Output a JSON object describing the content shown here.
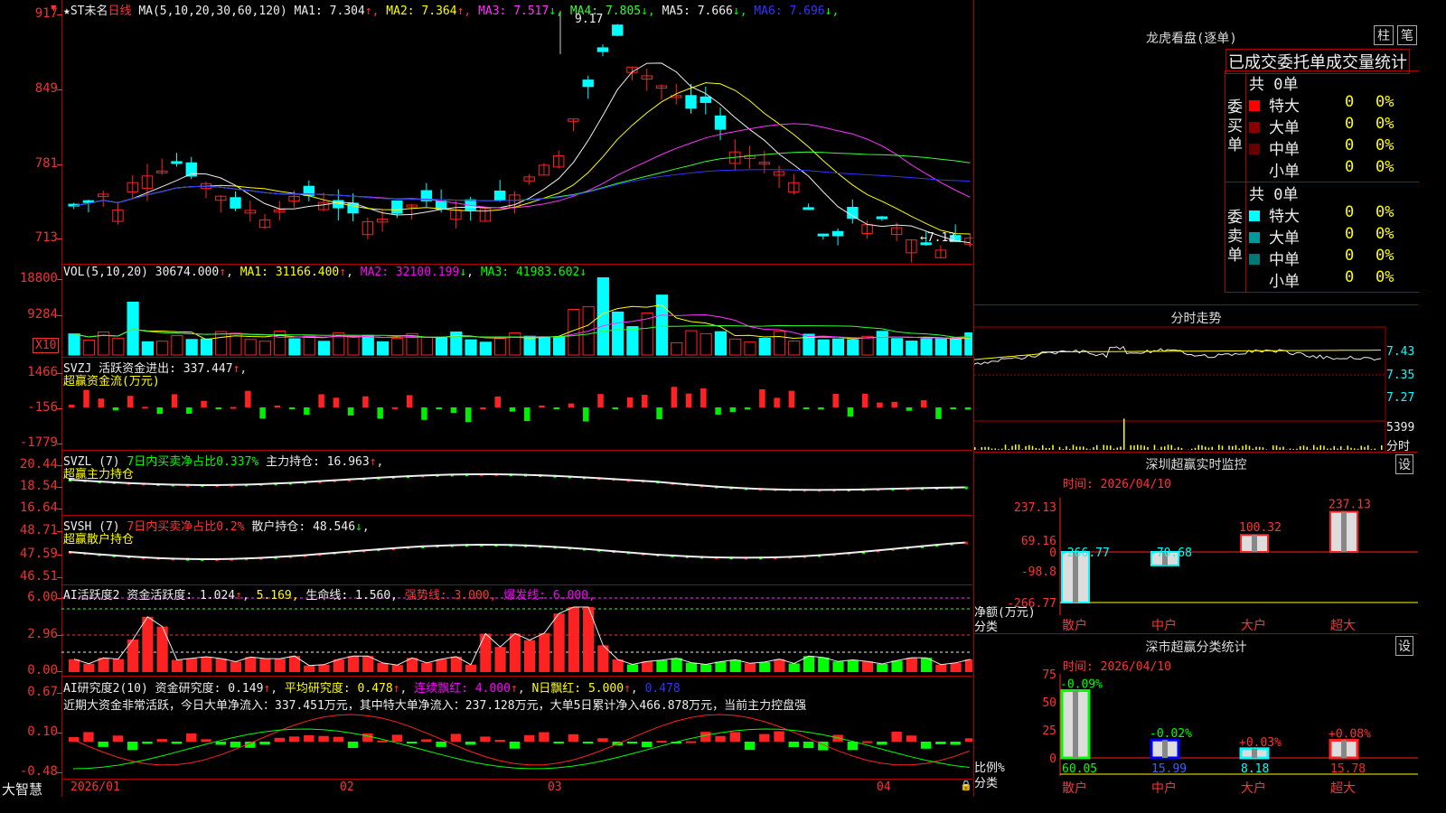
{
  "main": {
    "title_stock": "★ST未名",
    "title_period": "日线",
    "ma_label": "MA(5,10,20,30,60,120)",
    "ma": [
      {
        "label": "MA1: 7.304",
        "color": "#eeeeee",
        "arrow": "↑"
      },
      {
        "label": "MA2: 7.364",
        "color": "#ffff00",
        "arrow": "↑"
      },
      {
        "label": "MA3: 7.517",
        "color": "#ff33ff",
        "arrow": "↓"
      },
      {
        "label": "MA4: 7.805",
        "color": "#33ff33",
        "arrow": "↓"
      },
      {
        "label": "MA5: 7.666",
        "color": "#eeeeee",
        "arrow": "↓"
      },
      {
        "label": "MA6: 7.696",
        "color": "#3333ff",
        "arrow": "↓"
      }
    ],
    "high_marker": "9.17",
    "low_marker": "7.13",
    "y_labels": [
      "917",
      "849",
      "781",
      "713"
    ]
  },
  "vol": {
    "label": "VOL(5,10,20)",
    "value": "30674.000",
    "ma1": "MA1: 31166.400",
    "ma2": "MA2: 32100.199",
    "ma3": "MA3: 41983.602",
    "y_labels": [
      "18800",
      "9284"
    ],
    "unit": "X10"
  },
  "svzj": {
    "label": "SVZJ",
    "text": "活跃资金进出: 337.447",
    "sub": "超赢资金流(万元)",
    "y_labels": [
      "1466",
      "-156",
      "-1779"
    ]
  },
  "svzl": {
    "label": "SVZL (7)",
    "text1": "7日内买卖净占比0.337%",
    "text2": "主力持仓: 16.963",
    "sub": "超赢主力持仓",
    "y_labels": [
      "20.44",
      "18.54",
      "16.64"
    ]
  },
  "svsh": {
    "label": "SVSH (7)",
    "text1": "7日内买卖净占比0.2%",
    "text2": "散户持仓: 48.546",
    "sub": "超赢散户持仓",
    "y_labels": [
      "48.71",
      "47.59",
      "46.51"
    ]
  },
  "ai1": {
    "label": "AI活跃度2",
    "t1": "资金活跃度: 1.024",
    "t2": "5.169,",
    "t3": "生命线: 1.560,",
    "t4": "强势线: 3.000,",
    "t5": "爆发线: 6.000,",
    "y_labels": [
      "6.00",
      "2.96",
      "0.00"
    ]
  },
  "ai2": {
    "label": "AI研究度2(10)",
    "t1": "资金研究度: 0.149",
    "t2": "平均研究度: 0.478",
    "t3": "连续飘红: 4.000",
    "t4": "N日飘红: 5.000",
    "t5": "0.478",
    "comment": "近期大资金非常活跃，今日大单净流入：337.451万元，其中特大单净流入：237.128万元，大单5日累计净入466.878万元，当前主力控盘强",
    "y_labels": [
      "0.67",
      "0.10",
      "-0.48"
    ]
  },
  "xaxis": {
    "brand": "大智慧",
    "dates": [
      "2026/01",
      "02",
      "03",
      "04"
    ]
  },
  "longhu": {
    "title": "龙虎看盘(逐单)",
    "btn1": "柱",
    "btn2": "笔",
    "subtitle": "已成交委托单成交量统计",
    "buy_label": "委买单",
    "sell_label": "委卖单",
    "buy_total": "共 0单",
    "sell_total": "共 0单",
    "rows": [
      {
        "name": "特大",
        "val": "0",
        "pct": "0%"
      },
      {
        "name": "大单",
        "val": "0",
        "pct": "0%"
      },
      {
        "name": "中单",
        "val": "0",
        "pct": "0%"
      },
      {
        "name": "小单",
        "val": "0",
        "pct": "0%"
      }
    ]
  },
  "fenshi": {
    "title": "分时走势",
    "y_labels": [
      "7.43",
      "7.35",
      "7.27"
    ],
    "vol_label": "5399",
    "vol_unit": "分时"
  },
  "sz_monitor": {
    "title": "深圳超赢实时监控",
    "settings": "设",
    "date": "时间: 2026/04/10",
    "y_labels": [
      "237.13",
      "69.16",
      "0",
      "-98.8",
      "-266.77"
    ],
    "left_labels": [
      "净额(万元)",
      "分类"
    ],
    "bars": [
      {
        "cat": "散户",
        "value": -266.77,
        "label": "-266.77"
      },
      {
        "cat": "中户",
        "value": -70.68,
        "label": "-70.68"
      },
      {
        "cat": "大户",
        "value": 100.32,
        "label": "100.32"
      },
      {
        "cat": "超大",
        "value": 237.13,
        "label": "237.13"
      }
    ]
  },
  "sz_class": {
    "title": "深市超赢分类统计",
    "settings": "设",
    "date": "时间: 2026/04/10",
    "y_labels": [
      "75",
      "50",
      "25",
      "0"
    ],
    "left_labels": [
      "比例%",
      "分类"
    ],
    "bars": [
      {
        "cat": "散户",
        "value": 60.05,
        "pct": "-0.09%"
      },
      {
        "cat": "中户",
        "value": 15.99,
        "pct": "-0.02%"
      },
      {
        "cat": "大户",
        "value": 8.18,
        "pct": "+0.03%"
      },
      {
        "cat": "超大",
        "value": 15.78,
        "pct": "+0.08%"
      }
    ]
  },
  "colors": {
    "up": "#ff2222",
    "down": "#00ffff",
    "grid": "#aa0000"
  }
}
